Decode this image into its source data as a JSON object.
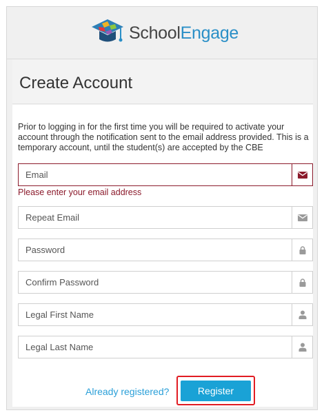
{
  "brand": {
    "name_part1": "School",
    "name_part2": "Engage",
    "accent_color": "#2a8fc7"
  },
  "page": {
    "title": "Create Account",
    "intro": "Prior to logging in for the first time you will be required to activate your account through the notification sent to the email address provided. This is a temporary account, until the student(s) are accepted by the CBE"
  },
  "form": {
    "fields": [
      {
        "placeholder": "Email",
        "value": "",
        "icon": "envelope-icon",
        "error": true
      },
      {
        "placeholder": "Repeat Email",
        "value": "",
        "icon": "envelope-icon",
        "error": false
      },
      {
        "placeholder": "Password",
        "value": "",
        "icon": "lock-icon",
        "error": false
      },
      {
        "placeholder": "Confirm Password",
        "value": "",
        "icon": "lock-icon",
        "error": false
      },
      {
        "placeholder": "Legal First Name",
        "value": "",
        "icon": "user-icon",
        "error": false
      },
      {
        "placeholder": "Legal Last Name",
        "value": "",
        "icon": "user-icon",
        "error": false
      }
    ],
    "email_error": "Please enter your email address",
    "error_color": "#8b1a2b"
  },
  "actions": {
    "already_registered": "Already registered?",
    "register": "Register",
    "register_color": "#1aa2d6",
    "highlight_color": "#e11b22"
  }
}
